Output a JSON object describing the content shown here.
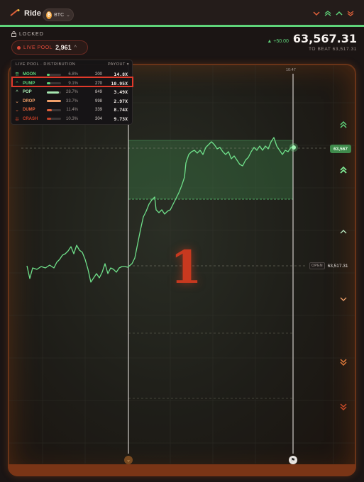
{
  "app": {
    "title": "Ride",
    "asset": "BTC",
    "asset_symbol": "₿"
  },
  "header": {
    "locked_label": "LOCKED",
    "live_pool_label": "LIVE POOL",
    "live_pool_value": "2,961",
    "price_change": "+50.00",
    "price": "63,567.31",
    "to_beat": "TO BEAT 63,517.31"
  },
  "distribution": {
    "title": "LIVE POOL · DISTRIBUTION",
    "payout_label": "PAYOUT ▾",
    "rows": [
      {
        "name": "MOON",
        "pct": "6.8%",
        "pct_fill": 0.068,
        "count": "200",
        "payout": "14.8X",
        "color": "#5fd47a",
        "icon": "⇈"
      },
      {
        "name": "PUMP",
        "pct": "9.1%",
        "pct_fill": 0.091,
        "count": "270",
        "payout": "10.95X",
        "color": "#5fd47a",
        "icon": "⌃"
      },
      {
        "name": "POP",
        "pct": "28.7%",
        "pct_fill": 0.287,
        "count": "849",
        "payout": "3.49X",
        "color": "#a6e6b0",
        "icon": "^"
      },
      {
        "name": "DROP",
        "pct": "33.7%",
        "pct_fill": 0.337,
        "count": "998",
        "payout": "2.97X",
        "color": "#f0a06a",
        "icon": "⌄"
      },
      {
        "name": "DUMP",
        "pct": "11.4%",
        "pct_fill": 0.114,
        "count": "339",
        "payout": "8.74X",
        "color": "#e0603a",
        "icon": "⌄"
      },
      {
        "name": "CRASH",
        "pct": "10.3%",
        "pct_fill": 0.103,
        "count": "304",
        "payout": "9.73X",
        "color": "#c84028",
        "icon": "⇊"
      }
    ]
  },
  "chart": {
    "time_label": "10:47",
    "current_price_tag": "63,567",
    "open_label": "OPEN",
    "open_value": "63,517.31",
    "countdown": "1"
  },
  "colors": {
    "accent_green": "#5fd47a",
    "danger_red": "#e0392a",
    "frame": "#6a3418"
  }
}
